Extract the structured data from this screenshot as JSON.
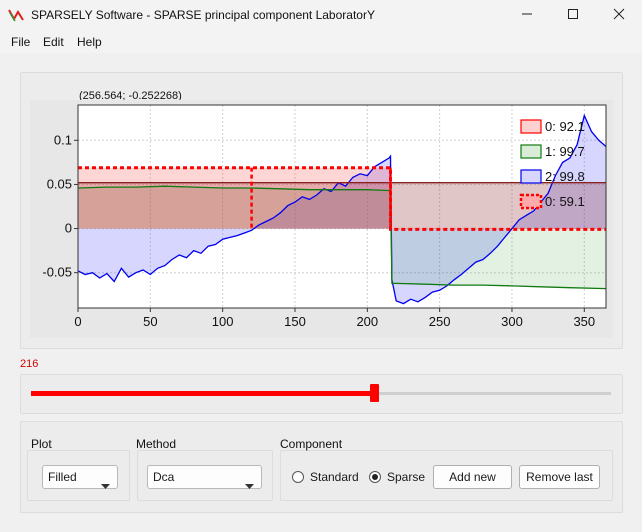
{
  "window": {
    "title": "SPARSELY Software - SPARSE principal component LaboratorY",
    "minimize_glyph": "─",
    "maximize_glyph": "☐",
    "close_glyph": "✕"
  },
  "menu": [
    "File",
    "Edit",
    "Help"
  ],
  "coords_readout": "(256.564; -0.252268)",
  "slider": {
    "value_label": "216",
    "value": 216,
    "min": 0,
    "max": 365
  },
  "controls": {
    "plot_label": "Plot",
    "plot_value": "Filled",
    "method_label": "Method",
    "method_value": "Dca",
    "component_label": "Component",
    "radio_standard": "Standard",
    "radio_sparse": "Sparse",
    "radio_selected": "Sparse",
    "add_button": "Add new",
    "remove_button": "Remove last"
  },
  "colors": {
    "red": "#ff0000",
    "green": "#117a11",
    "blue": "#0000ee",
    "dark": "#882222",
    "slider": "#ff0000",
    "slider_label": "#d20000",
    "app_icon": "#e02020"
  },
  "chart_data": {
    "type": "line",
    "fill": "filled",
    "xlim": [
      0,
      365
    ],
    "ylim": [
      -0.09,
      0.14
    ],
    "xticks": [
      0,
      50,
      100,
      150,
      200,
      250,
      300,
      350
    ],
    "yticks": [
      -0.05,
      0,
      0.05,
      0.1
    ],
    "ytick_labels": [
      "-0.05",
      "0",
      "0.05",
      "0.1"
    ],
    "grid": true,
    "legend_position": "top-right",
    "legend": [
      {
        "label": "0: 92.1",
        "color": "#ff0000",
        "fill": "#ffd0d0"
      },
      {
        "label": "1: 99.7",
        "color": "#117a11",
        "fill": "#d8ecd8"
      },
      {
        "label": "2: 99.8",
        "color": "#0000ee",
        "fill": "#d6d6ff"
      },
      {
        "label": "0: 59.1",
        "color": "#ff0000",
        "fill": "#ffaaaa",
        "dashed": true
      }
    ],
    "series": [
      {
        "name": "0: 92.1",
        "color": "#ff0000",
        "fill": "rgba(255,70,70,0.22)",
        "style": "dashed",
        "x": [
          0,
          120,
          120,
          216,
          216,
          365
        ],
        "y": [
          0.069,
          0.069,
          0.069,
          0.069,
          -0.001,
          -0.001
        ]
      },
      {
        "name": "1: 99.7",
        "color": "#117a11",
        "fill": "rgba(40,150,40,0.13)",
        "style": "solid",
        "x": [
          0,
          20,
          40,
          60,
          80,
          100,
          120,
          140,
          160,
          180,
          200,
          216,
          217,
          240,
          260,
          280,
          300,
          320,
          340,
          365
        ],
        "y": [
          0.046,
          0.047,
          0.047,
          0.048,
          0.047,
          0.046,
          0.046,
          0.045,
          0.044,
          0.044,
          0.044,
          0.043,
          -0.062,
          -0.063,
          -0.064,
          -0.064,
          -0.065,
          -0.066,
          -0.067,
          -0.068
        ]
      },
      {
        "name": "2: 99.8",
        "color": "#0000ee",
        "fill": "rgba(70,70,255,0.22)",
        "style": "solid",
        "x": [
          0,
          5,
          10,
          15,
          20,
          25,
          30,
          35,
          40,
          45,
          50,
          55,
          60,
          65,
          70,
          75,
          80,
          85,
          90,
          95,
          100,
          105,
          110,
          115,
          120,
          125,
          130,
          135,
          140,
          145,
          150,
          155,
          160,
          165,
          170,
          175,
          180,
          185,
          190,
          195,
          200,
          205,
          210,
          215,
          216,
          217,
          220,
          225,
          230,
          235,
          240,
          245,
          250,
          255,
          260,
          265,
          270,
          275,
          280,
          285,
          290,
          295,
          300,
          305,
          310,
          315,
          320,
          325,
          330,
          335,
          340,
          345,
          350,
          355,
          360,
          365
        ],
        "y": [
          -0.048,
          -0.052,
          -0.05,
          -0.056,
          -0.051,
          -0.06,
          -0.045,
          -0.055,
          -0.05,
          -0.047,
          -0.052,
          -0.045,
          -0.042,
          -0.035,
          -0.03,
          -0.033,
          -0.025,
          -0.028,
          -0.02,
          -0.018,
          -0.012,
          -0.01,
          -0.008,
          -0.005,
          -0.002,
          0.004,
          0.008,
          0.012,
          0.018,
          0.026,
          0.03,
          0.036,
          0.033,
          0.038,
          0.045,
          0.042,
          0.052,
          0.048,
          0.058,
          0.062,
          0.06,
          0.07,
          0.075,
          0.08,
          0.082,
          -0.058,
          -0.082,
          -0.085,
          -0.08,
          -0.083,
          -0.078,
          -0.072,
          -0.07,
          -0.065,
          -0.058,
          -0.052,
          -0.045,
          -0.038,
          -0.035,
          -0.028,
          -0.02,
          -0.01,
          0.0,
          0.01,
          0.015,
          0.02,
          0.03,
          0.04,
          0.06,
          0.075,
          0.08,
          0.095,
          0.128,
          0.11,
          0.1,
          0.093
        ]
      },
      {
        "name": "dark",
        "color": "#882222",
        "fill": "rgba(136,34,34,0.26)",
        "style": "solid",
        "x": [
          0,
          216,
          216,
          365
        ],
        "y": [
          0.052,
          0.052,
          0.052,
          0.052
        ]
      }
    ],
    "marker": {
      "x": 216,
      "color": "#ff0000"
    },
    "highlight_segment": {
      "x": [
        120,
        216
      ],
      "color": "#ff0000"
    }
  }
}
